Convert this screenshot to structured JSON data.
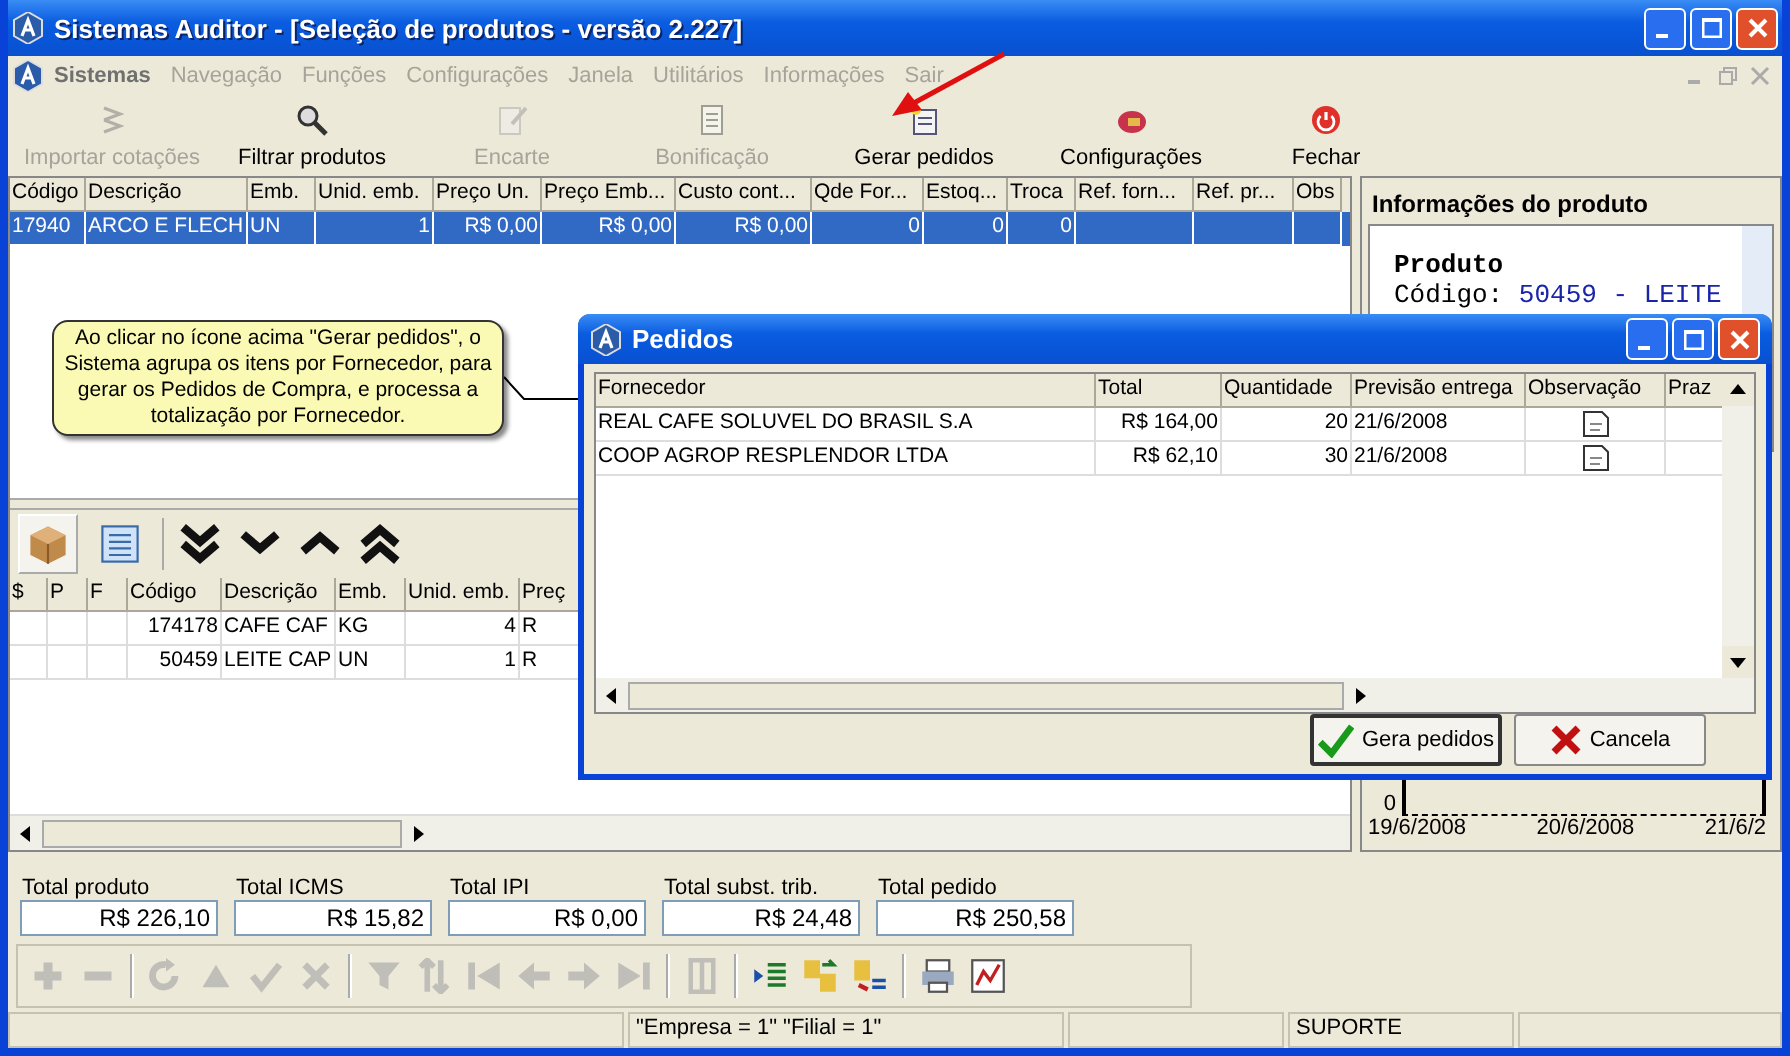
{
  "window": {
    "title": "Sistemas Auditor - [Seleção de produtos - versão 2.227]"
  },
  "menu": [
    {
      "label": "Sistemas",
      "disabled": false
    },
    {
      "label": "Navegação",
      "disabled": true
    },
    {
      "label": "Funções",
      "disabled": true
    },
    {
      "label": "Configurações",
      "disabled": true
    },
    {
      "label": "Janela",
      "disabled": true
    },
    {
      "label": "Utilitários",
      "disabled": true
    },
    {
      "label": "Informações",
      "disabled": true
    },
    {
      "label": "Sair",
      "disabled": true
    }
  ],
  "toolbar": [
    {
      "label": "Importar cotações",
      "disabled": true
    },
    {
      "label": "Filtrar produtos",
      "disabled": false
    },
    {
      "label": "Encarte",
      "disabled": true
    },
    {
      "label": "Bonificação",
      "disabled": true
    },
    {
      "label": "Gerar pedidos",
      "disabled": false
    },
    {
      "label": "Configurações",
      "disabled": false
    },
    {
      "label": "Fechar",
      "disabled": false
    }
  ],
  "products_table": {
    "columns": [
      "Código",
      "Descrição",
      "Emb.",
      "Unid. emb.",
      "Preço Un.",
      "Preço Emb...",
      "Custo cont...",
      "Qde For...",
      "Estoq...",
      "Troca",
      "Ref. forn...",
      "Ref. pr...",
      "Obs"
    ],
    "rows": [
      {
        "selected": true,
        "cells": [
          "17940",
          "ARCO E FLECH",
          "UN",
          "1",
          "R$ 0,00",
          "R$ 0,00",
          "R$ 0,00",
          "0",
          "0",
          "0",
          "",
          "",
          ""
        ]
      }
    ]
  },
  "callout": {
    "text": "Ao clicar no ícone acima \"Gerar pedidos\", o Sistema agrupa os itens por Fornecedor, para gerar os Pedidos de Compra, e processa a totalização por Fornecedor."
  },
  "view_tabs": [
    {
      "selected": true
    },
    {
      "selected": false
    }
  ],
  "items_table": {
    "columns": [
      "$",
      "P",
      "F",
      "Código",
      "Descrição",
      "Emb.",
      "Unid. emb.",
      "Preç"
    ],
    "rows": [
      [
        "",
        "",
        "",
        "174178",
        "CAFE CAF",
        "KG",
        "4",
        "R"
      ],
      [
        "",
        "",
        "",
        "50459",
        "LEITE CAP",
        "UN",
        "1",
        "R"
      ]
    ]
  },
  "product_info": {
    "title": "Informações do produto",
    "heading": "Produto",
    "code_label": "Código:",
    "code_value": "50459 - LEITE"
  },
  "chart": {
    "y_tick": "0",
    "x_labels": [
      "19/6/2008",
      "20/6/2008",
      "21/6/2"
    ]
  },
  "totals": [
    {
      "label": "Total produto",
      "value": "R$ 226,10"
    },
    {
      "label": "Total ICMS",
      "value": "R$ 15,82"
    },
    {
      "label": "Total IPI",
      "value": "R$ 0,00"
    },
    {
      "label": "Total subst. trib.",
      "value": "R$ 24,48"
    },
    {
      "label": "Total pedido",
      "value": "R$ 250,58"
    }
  ],
  "bottom_toolbar": [
    [
      {
        "disabled": true
      },
      {
        "disabled": true
      }
    ],
    [
      {
        "disabled": true
      },
      {
        "disabled": true
      },
      {
        "disabled": true
      },
      {
        "disabled": true
      }
    ],
    [
      {
        "disabled": true
      },
      {
        "disabled": true
      },
      {
        "disabled": true
      },
      {
        "disabled": true
      },
      {
        "disabled": true
      },
      {
        "disabled": true
      }
    ],
    [
      {
        "disabled": true
      }
    ],
    [
      {
        "disabled": false
      },
      {
        "disabled": false
      },
      {
        "disabled": false
      }
    ],
    [
      {
        "disabled": false
      },
      {
        "disabled": false
      }
    ]
  ],
  "status_bar": {
    "company": "\"Empresa = 1\"  \"Filial = 1\"",
    "user": "SUPORTE"
  },
  "dialog": {
    "title": "Pedidos",
    "columns": [
      "Fornecedor",
      "Total",
      "Quantidade",
      "Previsão entrega",
      "Observação",
      "Praz"
    ],
    "rows": [
      [
        "REAL CAFE SOLUVEL DO BRASIL S.A",
        "R$ 164,00",
        "20",
        "21/6/2008"
      ],
      [
        "COOP AGROP RESPLENDOR LTDA",
        "R$ 62,10",
        "30",
        "21/6/2008"
      ]
    ],
    "buttons": [
      "Gera pedidos",
      "Cancela"
    ]
  }
}
